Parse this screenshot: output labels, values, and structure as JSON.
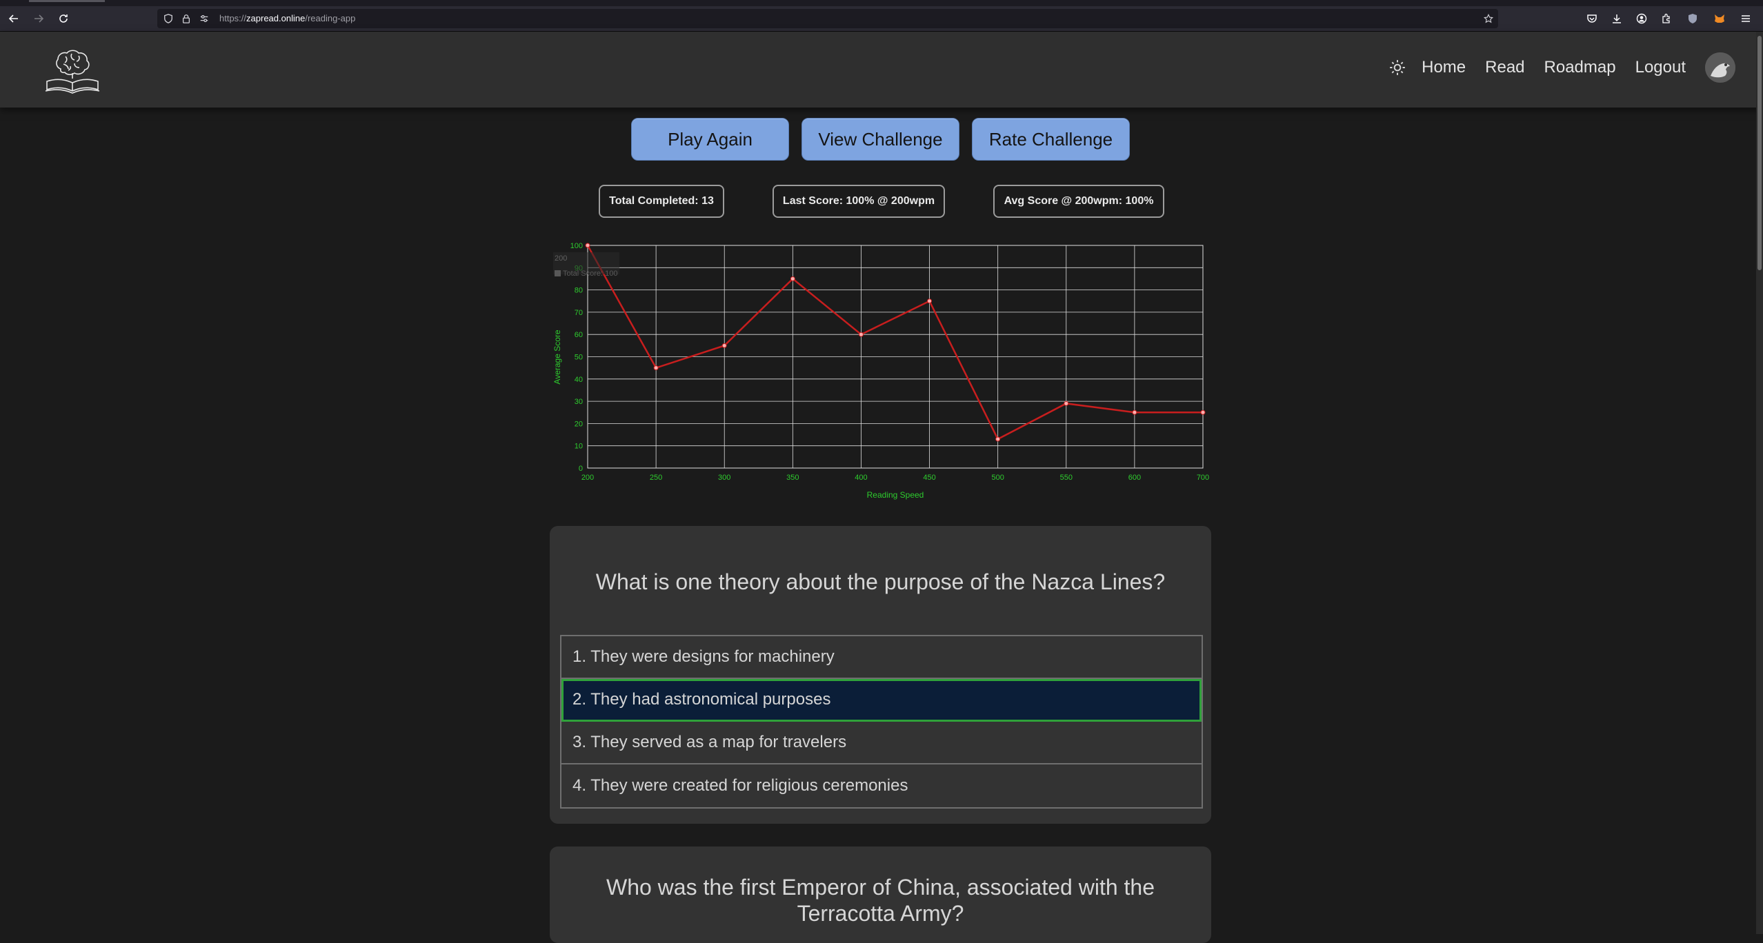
{
  "browser": {
    "url_prefix": "https://",
    "url_host": "zapread.online",
    "url_path": "/reading-app"
  },
  "nav": {
    "home": "Home",
    "read": "Read",
    "roadmap": "Roadmap",
    "logout": "Logout"
  },
  "actions": {
    "play_again": "Play Again",
    "view_challenge": "View Challenge",
    "rate_challenge": "Rate Challenge"
  },
  "stats": {
    "total_completed": "Total Completed: 13",
    "last_score": "Last Score: 100% @ 200wpm",
    "avg_score": "Avg Score @ 200wpm: 100%"
  },
  "chart_data": {
    "type": "line",
    "xlabel": "Reading Speed",
    "ylabel": "Average Score",
    "x": [
      200,
      250,
      300,
      350,
      400,
      450,
      500,
      550,
      600,
      700
    ],
    "x_ticks": [
      "200",
      "250",
      "300",
      "350",
      "400",
      "450",
      "500",
      "550",
      "600",
      "700"
    ],
    "y_ticks": [
      "0",
      "10",
      "20",
      "30",
      "40",
      "50",
      "60",
      "70",
      "80",
      "90",
      "100"
    ],
    "ylim": [
      0,
      100
    ],
    "series": [
      {
        "values": [
          100,
          45,
          55,
          85,
          60,
          75,
          13,
          29,
          25,
          25
        ],
        "color": "#c81e1e"
      }
    ],
    "tooltip": {
      "title": "200",
      "line": "Total Score: 100"
    },
    "grid": true,
    "colors": {
      "axis_text": "#2ecc2e",
      "grid": "#e0e0e0",
      "point": "#ffb0b0"
    }
  },
  "questions": [
    {
      "title": "What is one theory about the purpose of the Nazca Lines?",
      "options": [
        "1. They were designs for machinery",
        "2. They had astronomical purposes",
        "3. They served as a map for travelers",
        "4. They were created for religious ceremonies"
      ],
      "selected_index": 1
    },
    {
      "title": "Who was the first Emperor of China, associated with the Terracotta Army?"
    }
  ]
}
